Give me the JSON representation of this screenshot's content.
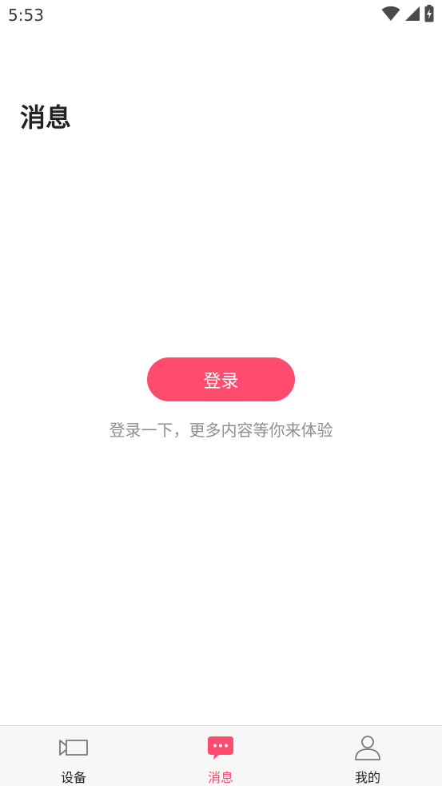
{
  "status_bar": {
    "time": "5:53",
    "icons": [
      "wifi-icon",
      "cell-signal-icon",
      "battery-charging-icon"
    ]
  },
  "page": {
    "title": "消息"
  },
  "login": {
    "button_label": "登录",
    "hint": "登录一下，更多内容等你来体验"
  },
  "bottom_nav": {
    "items": [
      {
        "label": "设备",
        "icon": "device-icon",
        "active": false
      },
      {
        "label": "消息",
        "icon": "chat-bubble-icon",
        "active": true
      },
      {
        "label": "我的",
        "icon": "profile-icon",
        "active": false
      }
    ]
  },
  "colors": {
    "accent": "#ff4b6e",
    "title_text": "#222222",
    "hint_text": "#8e8e8e",
    "nav_background": "#f7f7f7",
    "inactive_icon": "#7a7a7a"
  }
}
